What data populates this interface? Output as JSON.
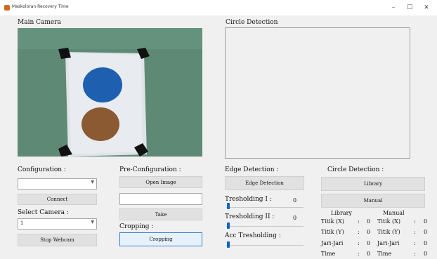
{
  "window": {
    "title": "Maskoloran Recovery Time",
    "controls": {
      "minimize": "–",
      "maximize": "☐",
      "close": "✕"
    }
  },
  "main_camera": {
    "label": "Main Camera"
  },
  "circle_detection_view": {
    "label": "Circle Detection"
  },
  "configuration": {
    "label": "Configuration :",
    "port_value": "",
    "connect_label": "Connect",
    "select_camera_label": "Select Camera :",
    "camera_value": "1",
    "stop_webcam_label": "Stop Webcam"
  },
  "pre_configuration": {
    "label": "Pre-Configuration :",
    "open_image_label": "Open Image",
    "path_value": "",
    "take_label": "Take",
    "cropping_label": "Cropping :",
    "cropping_button": "Cropping"
  },
  "edge_detection": {
    "label": "Edge Detection :",
    "button_label": "Edge Detection",
    "threshold1_label": "Tresholding I :",
    "threshold1_value": "0",
    "threshold2_label": "Tresholding II :",
    "threshold2_value": "0",
    "acc_label": "Acc Tresholding :"
  },
  "circle_detection": {
    "label": "Circle Detection :",
    "library_button": "Library",
    "manual_button": "Manual",
    "col_library": "Library",
    "col_manual": "Manual",
    "rows": [
      {
        "name": "Titik (X)",
        "sep": ":",
        "lib": "0",
        "man": "0"
      },
      {
        "name": "Titik (Y)",
        "sep": ":",
        "lib": "0",
        "man": "0"
      },
      {
        "name": "Jari-Jari",
        "sep": ":",
        "lib": "0",
        "man": "0"
      },
      {
        "name": "Time",
        "sep": ":",
        "lib": "0",
        "man": "0"
      }
    ]
  }
}
